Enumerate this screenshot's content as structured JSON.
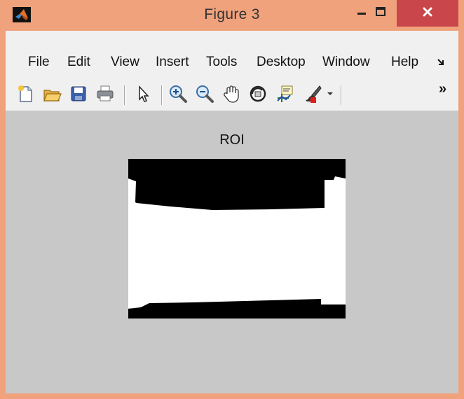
{
  "window": {
    "title": "Figure 3",
    "buttons": {
      "minimize": "minimize",
      "maximize": "maximize",
      "close": "close"
    }
  },
  "menu": {
    "items": [
      "File",
      "Edit",
      "View",
      "Insert",
      "Tools",
      "Desktop",
      "Window",
      "Help"
    ],
    "overflow_icon": "dock-arrow-icon"
  },
  "toolbar": {
    "icons": [
      "new-figure-icon",
      "open-file-icon",
      "save-icon",
      "print-icon",
      "edit-plot-arrow-icon",
      "zoom-in-icon",
      "zoom-out-icon",
      "pan-hand-icon",
      "rotate-3d-icon",
      "data-cursor-icon",
      "brush-icon",
      "brush-dropdown-icon",
      "toolbar-overflow-icon"
    ],
    "overflow_label": "»"
  },
  "figure": {
    "axes_title": "ROI"
  },
  "colors": {
    "window_frame": "#f0a27c",
    "close_button": "#c9464a",
    "figure_background": "#c8c8c8"
  }
}
